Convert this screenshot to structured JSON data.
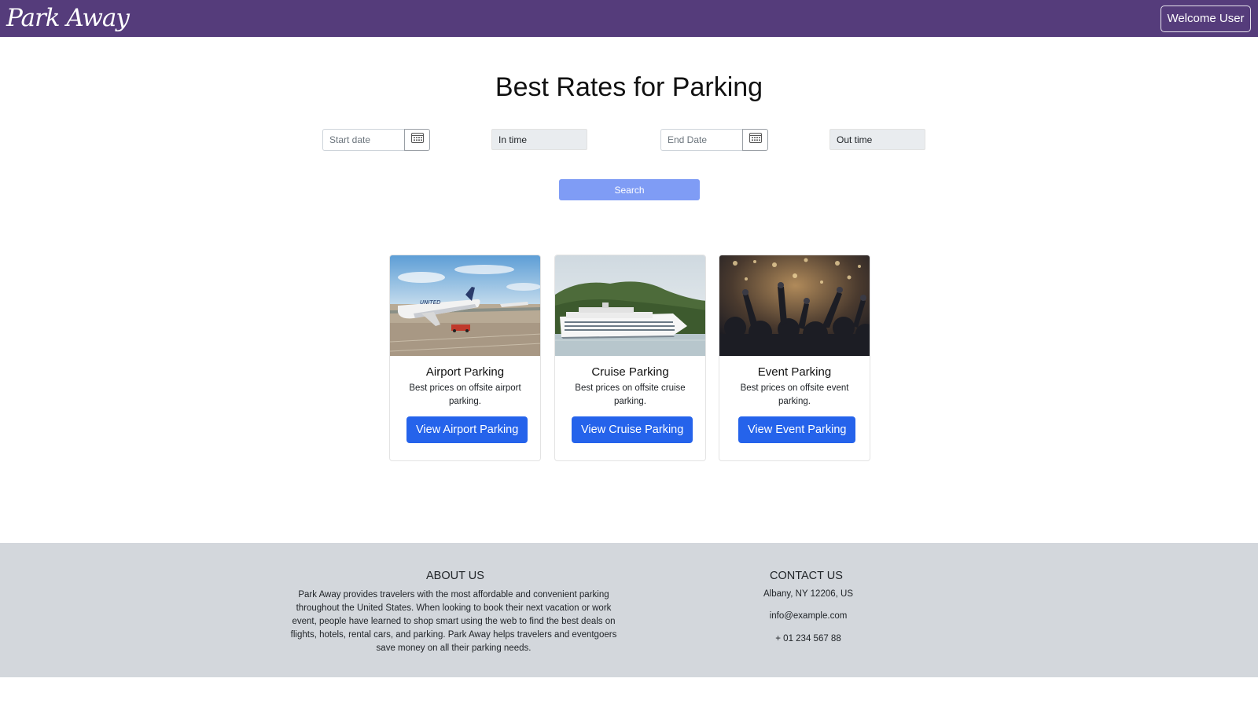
{
  "navbar": {
    "brand": "Park Away",
    "welcome_label": "Welcome User"
  },
  "hero": {
    "title": "Best Rates for Parking",
    "start_date_placeholder": "Start date",
    "in_time_placeholder": "In time",
    "end_date_placeholder": "End Date",
    "out_time_placeholder": "Out time",
    "search_label": "Search"
  },
  "cards": [
    {
      "title": "Airport Parking",
      "text": "Best prices on offsite airport parking.",
      "button": "View Airport Parking",
      "image": "airport-photo"
    },
    {
      "title": "Cruise Parking",
      "text": "Best prices on offsite cruise parking.",
      "button": "View Cruise Parking",
      "image": "cruise-ship-photo"
    },
    {
      "title": "Event Parking",
      "text": "Best prices on offsite event parking.",
      "button": "View Event Parking",
      "image": "concert-crowd-photo"
    }
  ],
  "footer": {
    "about_heading": "ABOUT US",
    "about_text": "Park Away provides travelers with the most affordable and convenient parking throughout the United States. When looking to book their next vacation or work event, people have learned to shop smart using the web to find the best deals on flights, hotels, rental cars, and parking. Park Away helps travelers and eventgoers save money on all their parking needs.",
    "contact_heading": "CONTACT US",
    "address": "Albany, NY 12206, US",
    "email": "info@example.com",
    "phone": "+ 01 234 567 88"
  },
  "icons": {
    "calendar": "calendar-icon"
  },
  "colors": {
    "navbar": "#553c7b",
    "search_button": "#7f9cf5",
    "primary_button": "#2563eb",
    "footer": "#d3d7dc"
  }
}
